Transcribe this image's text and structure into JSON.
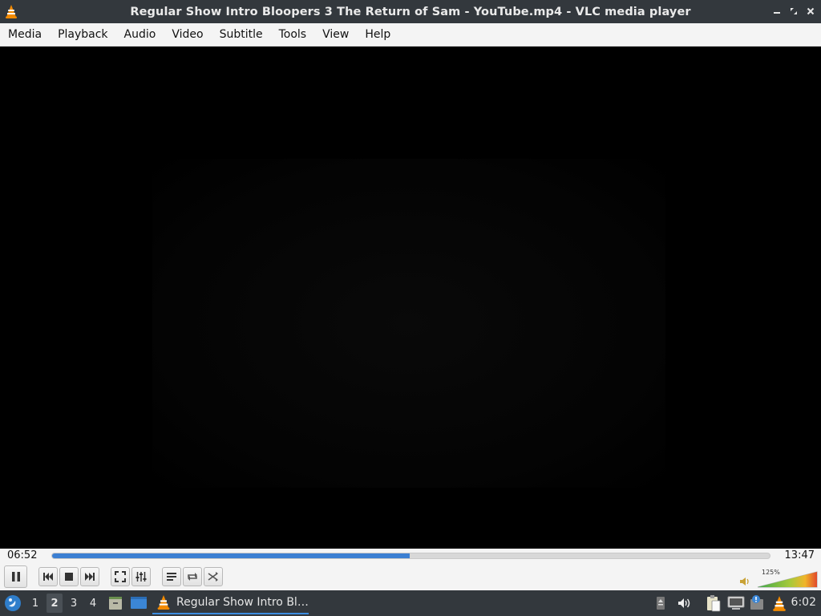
{
  "window": {
    "title": "Regular Show Intro Bloopers 3 The Return of Sam - YouTube.mp4 - VLC media player",
    "icon": "vlc-cone-icon",
    "controls": [
      "minimize-icon",
      "maximize-icon",
      "close-icon"
    ]
  },
  "menubar": {
    "items": [
      "Media",
      "Playback",
      "Audio",
      "Video",
      "Subtitle",
      "Tools",
      "View",
      "Help"
    ]
  },
  "player": {
    "elapsed": "06:52",
    "total": "13:47",
    "progress_fraction": 0.498,
    "volume_label": "125%",
    "volume_fraction": 1.0
  },
  "controls": {
    "buttons": [
      "pause",
      "previous",
      "stop",
      "next",
      "fullscreen",
      "extended-settings",
      "playlist",
      "loop",
      "random"
    ]
  },
  "taskbar": {
    "workspaces": [
      "1",
      "2",
      "3",
      "4"
    ],
    "active_workspace": "2",
    "task_label": "Regular Show Intro Bl…",
    "clock": "6:02",
    "colors": {
      "accent": "#3c8de0",
      "panel": "#33383d"
    }
  }
}
